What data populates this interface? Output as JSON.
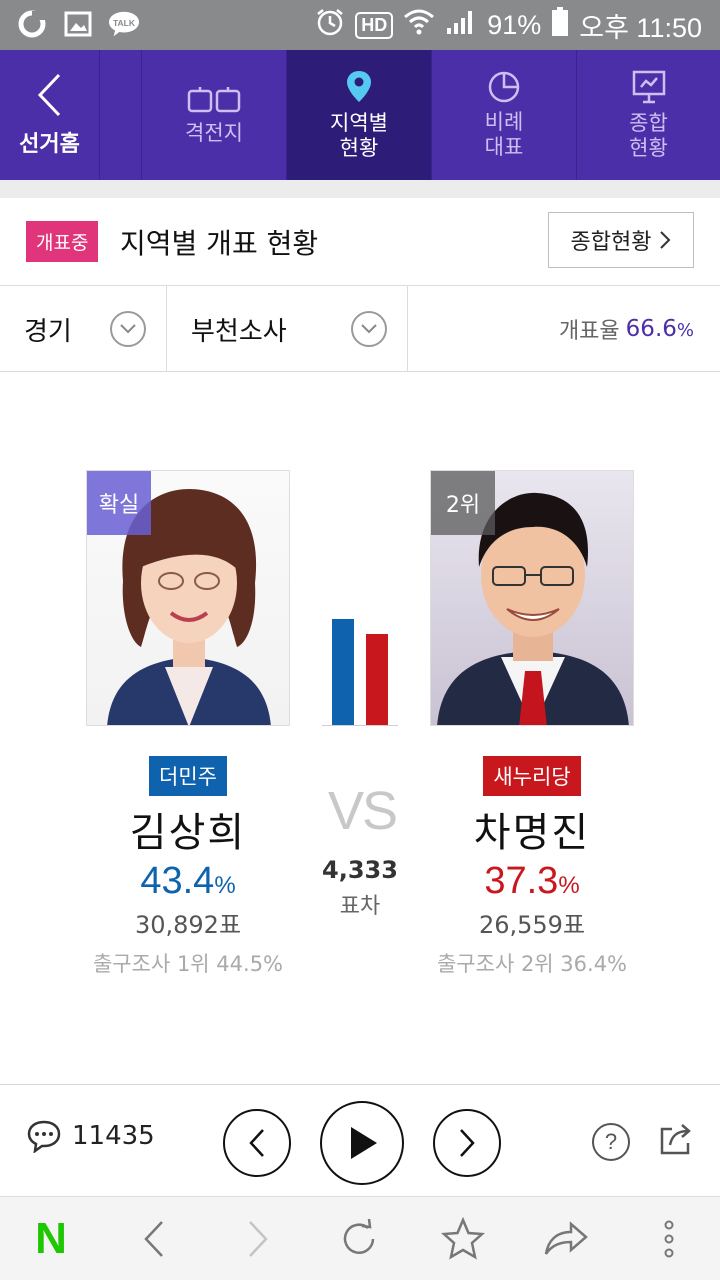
{
  "status_bar": {
    "battery": "91%",
    "time": "오후 11:50",
    "hd": "HD"
  },
  "nav": {
    "back_label": "선거홈",
    "items": [
      {
        "label": "격전지",
        "icon": "battleground-icon"
      },
      {
        "label": "지역별\n현황",
        "icon": "location-pin-icon"
      },
      {
        "label": "비례\n대표",
        "icon": "pie-chart-icon"
      },
      {
        "label": "종합\n현황",
        "icon": "presentation-board-icon"
      }
    ]
  },
  "header": {
    "badge": "개표중",
    "title": "지역별 개표 현황",
    "summary_button": "종합현황"
  },
  "selectors": {
    "province": "경기",
    "district": "부천소사",
    "count_rate_label": "개표율",
    "count_rate_value": "66.6",
    "count_rate_unit": "%"
  },
  "candidates": [
    {
      "tag": "확실",
      "party": "더민주",
      "name": "김상희",
      "pct_value": "43.4",
      "pct_unit": "%",
      "votes": "30,892표",
      "exit_poll": "출구조사 1위 44.5%",
      "color": "#0f62ae",
      "share": 0.434
    },
    {
      "tag": "2위",
      "party": "새누리당",
      "name": "차명진",
      "pct_value": "37.3",
      "pct_unit": "%",
      "votes": "26,559표",
      "exit_poll": "출구조사 2위 36.4%",
      "color": "#c9171e",
      "share": 0.373
    }
  ],
  "versus": {
    "vs": "VS",
    "margin_votes": "4,333",
    "margin_label": "표차"
  },
  "controls": {
    "comment_count": "11435",
    "help": "?"
  },
  "browser": {
    "logo": "N"
  }
}
